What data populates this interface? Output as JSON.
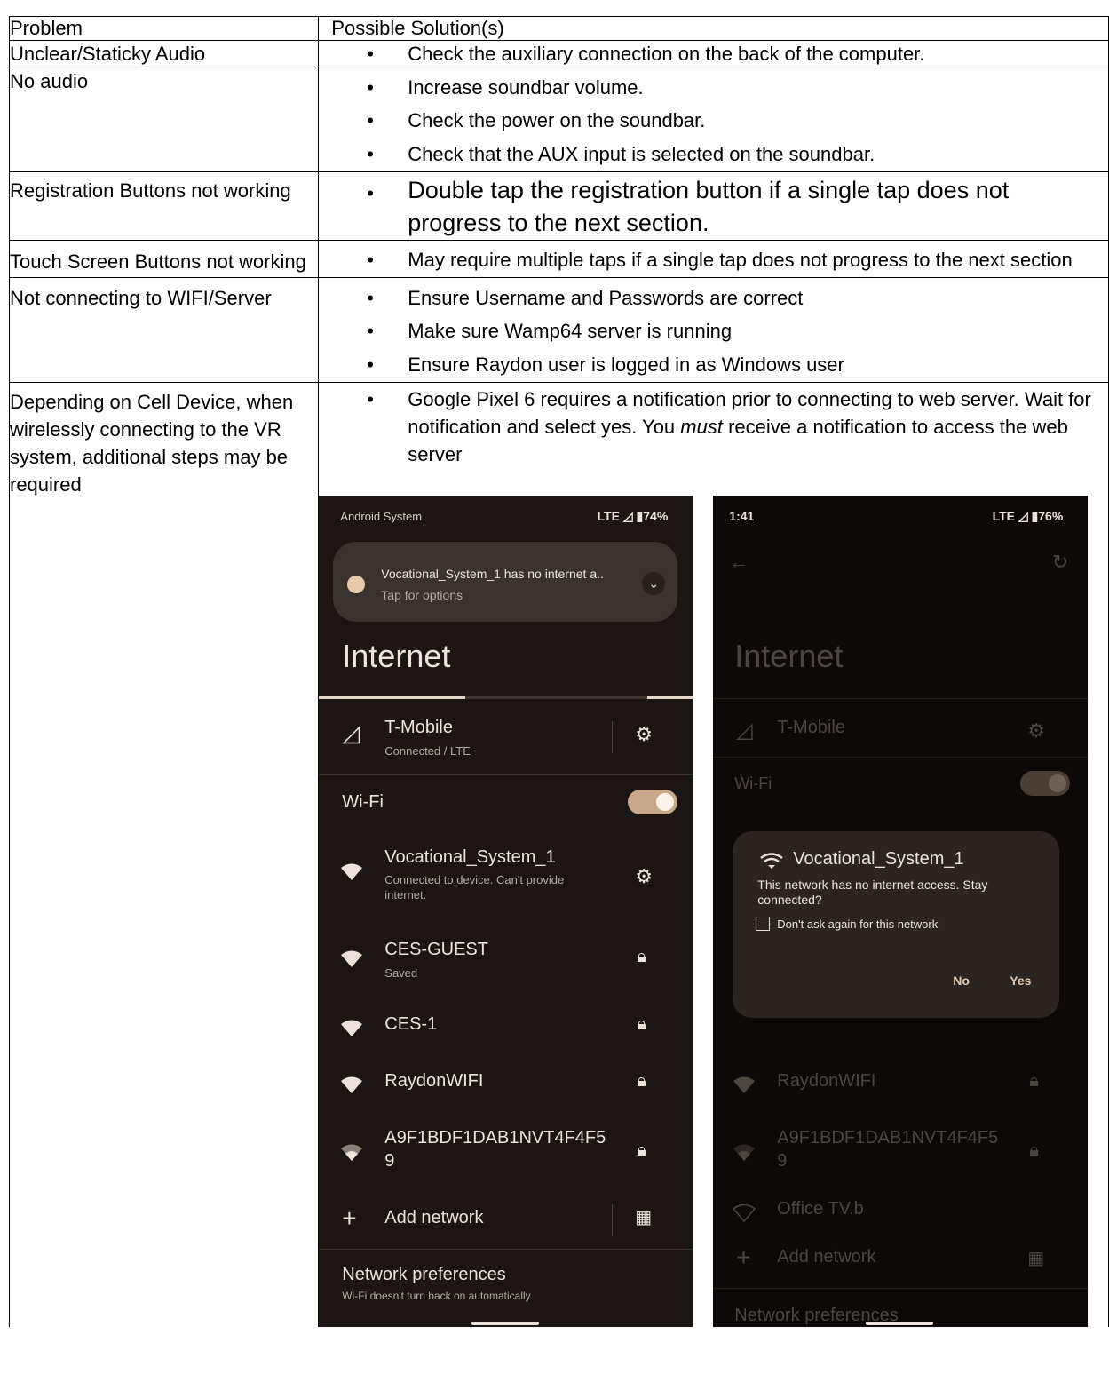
{
  "table": {
    "header": {
      "problem": "Problem",
      "solution": "Possible Solution(s)"
    },
    "rows": [
      {
        "problem": "Unclear/Staticky Audio",
        "solutions": [
          "Check the auxiliary connection on the back of the computer."
        ]
      },
      {
        "problem": "No audio",
        "solutions": [
          "Increase soundbar volume.",
          "Check the power on the soundbar.",
          "Check that the AUX input is selected on the soundbar."
        ]
      },
      {
        "problem": "Registration Buttons not working",
        "solutions": [
          "Double tap the registration button if a single tap does not progress to the next section."
        ]
      },
      {
        "problem": "Touch Screen Buttons not working",
        "solutions": [
          "May require multiple taps if a single tap does not progress to the next section"
        ]
      },
      {
        "problem": "Not connecting to WIFI/Server",
        "solutions": [
          "Ensure Username and Passwords are correct",
          "Make sure Wamp64 server is running",
          "Ensure Raydon user is logged in as Windows user"
        ]
      },
      {
        "problem": "Depending on Cell Device, when wirelessly connecting to the VR system, additional steps may be required",
        "solution_part1": "Google Pixel 6 requires a notification prior to connecting to web server.  Wait for notification and select yes.  You ",
        "solution_em": "must",
        "solution_part2": " receive a notification to access the web server"
      }
    ]
  },
  "screenshot_left": {
    "status_left": "Android System",
    "status_right": "LTE ◿ ▮74%",
    "notification_title": "Vocational_System_1 has no internet a..",
    "notification_sub": "Tap for options",
    "page_title": "Internet",
    "carrier_name": "T-Mobile",
    "carrier_status": "Connected / LTE",
    "wifi_label": "Wi-Fi",
    "networks": [
      {
        "name": "Vocational_System_1",
        "status": "Connected to device. Can't provide internet."
      },
      {
        "name": "CES-GUEST",
        "status": "Saved"
      },
      {
        "name": "CES-1",
        "status": ""
      },
      {
        "name": "RaydonWIFI",
        "status": ""
      },
      {
        "name": "A9F1BDF1DAB1NVT4F4F5",
        "name2": "9",
        "status": ""
      }
    ],
    "add_network": "Add network",
    "prefs_title": "Network preferences",
    "prefs_sub": "Wi-Fi doesn't turn back on automatically"
  },
  "screenshot_right": {
    "status_left": "1:41",
    "status_right": "LTE ◿ ▮76%",
    "page_title": "Internet",
    "carrier_name": "T-Mobile",
    "wifi_label": "Wi-Fi",
    "dialog_title": "Vocational_System_1",
    "dialog_body": "This network has no internet access. Stay connected?",
    "dialog_checkbox": "Don't ask again for this network",
    "dialog_no": "No",
    "dialog_yes": "Yes",
    "networks": [
      {
        "name": "RaydonWIFI"
      },
      {
        "name": "A9F1BDF1DAB1NVT4F4F5",
        "name2": "9"
      },
      {
        "name": "Office TV.b"
      }
    ],
    "add_network": "Add network",
    "prefs_title": "Network preferences"
  }
}
